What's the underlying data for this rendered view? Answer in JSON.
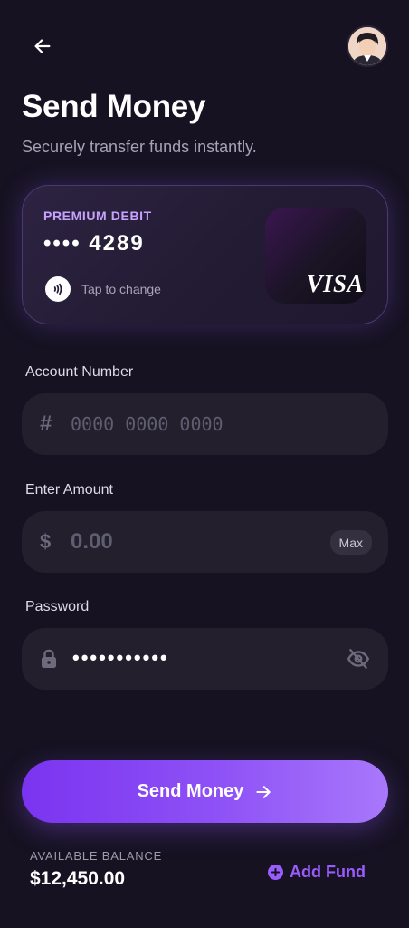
{
  "header": {
    "back_icon": "arrow-left-icon",
    "avatar_icon": "user-avatar"
  },
  "title": "Send Money",
  "subtitle": "Securely transfer funds instantly.",
  "card": {
    "type": "PREMIUM DEBIT",
    "number": "•••• 4289",
    "tap_label": "Tap to change",
    "brand": "VISA",
    "tap_icon": "contactless-icon"
  },
  "account": {
    "label": "Account Number",
    "placeholder": "0000 0000 0000",
    "icon": "#"
  },
  "amount": {
    "label": "Enter Amount",
    "placeholder": "0.00",
    "icon": "$",
    "max_label": "Max"
  },
  "password": {
    "label": "Password",
    "masked": "•••••••••••",
    "icon": "lock-icon",
    "toggle_icon": "eye-off-icon"
  },
  "send_button": {
    "label": "Send Money",
    "icon": "arrow-right-icon"
  },
  "balance": {
    "label": "AVAILABLE BALANCE",
    "value": "$12,450.00"
  },
  "add_fund": {
    "label": "Add Fund",
    "icon": "plus-circle-icon"
  },
  "colors": {
    "background": "#161221",
    "accent": "#9a5cff",
    "card_label": "#c7a3ff",
    "field_bg": "#231f2c"
  }
}
